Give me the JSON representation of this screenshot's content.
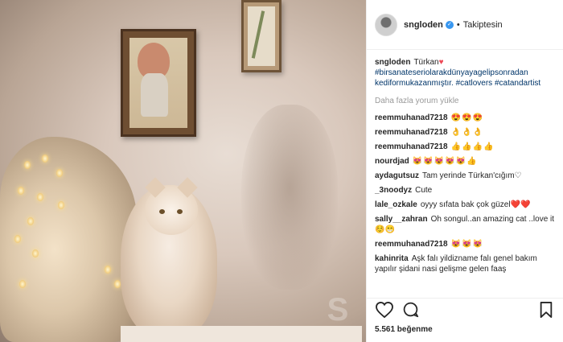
{
  "header": {
    "username": "sngloden",
    "verified_mark": "✓",
    "separator": "•",
    "follow_status": "Takiptesin"
  },
  "caption": {
    "username": "sngloden",
    "text": "Türkan",
    "heart": "♥",
    "hashtags": "#birsanateseriolarakdünyayagelipsonradan kediformukazanmıştır. #catlovers #catandartist"
  },
  "more_comments": "Daha fazla yorum yükle",
  "comments": [
    {
      "user": "reemmuhanad7218",
      "text": "😍😍😍"
    },
    {
      "user": "reemmuhanad7218",
      "text": "👌👌👌"
    },
    {
      "user": "reemmuhanad7218",
      "text": "👍👍👍👍"
    },
    {
      "user": "nourdjad",
      "text": "😻😻😻😻😻👍"
    },
    {
      "user": "aydagutsuz",
      "text": "Tam yerinde Türkan'cığım♡"
    },
    {
      "user": "_3noodyz",
      "text": "Cute"
    },
    {
      "user": "lale_ozkale",
      "text": "oyyy sıfata bak çok güzel❤️❤️"
    },
    {
      "user": "sally__zahran",
      "text": "Oh songul..an amazing cat ..love it ☺️😁"
    },
    {
      "user": "reemmuhanad7218",
      "text": "😻😻😻"
    },
    {
      "user": "kahinrita",
      "text": "Aşk falı yildizname falı genel bakım yapılır şidani nasi gelişme gelen faaş"
    }
  ],
  "actions": {
    "like_icon": "heart-icon",
    "comment_icon": "comment-bubble-icon",
    "save_icon": "bookmark-icon"
  },
  "likes": "5.561 beğenme",
  "photo": {
    "watermark": "S"
  }
}
